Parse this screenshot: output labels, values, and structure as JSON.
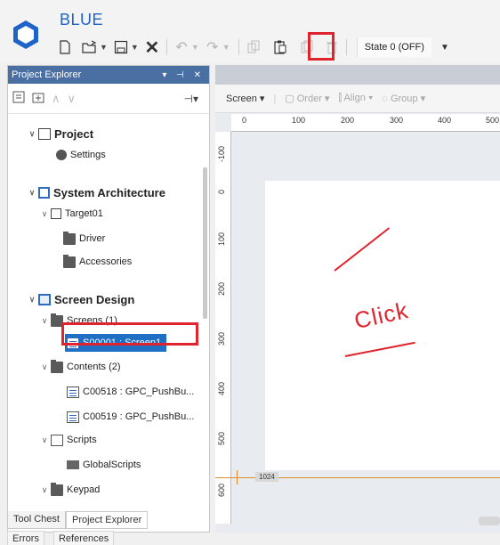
{
  "app": {
    "title": "BLUE"
  },
  "toolbar": {
    "state_label": "State 0 (OFF)"
  },
  "panel": {
    "title": "Project Explorer"
  },
  "tree": {
    "project": "Project",
    "settings": "Settings",
    "system_architecture": "System Architecture",
    "target": "Target01",
    "driver": "Driver",
    "accessories": "Accessories",
    "screen_design": "Screen Design",
    "screens": "Screens (1)",
    "screen1": "S00001 : Screen1",
    "contents": "Contents (2)",
    "content1": "C00518 : GPC_PushBu...",
    "content2": "C00519 : GPC_PushBu...",
    "scripts": "Scripts",
    "global_scripts": "GlobalScripts",
    "keypad": "Keypad"
  },
  "bottom_tabs": {
    "tool_chest": "Tool Chest",
    "project_explorer": "Project Explorer",
    "errors": "Errors",
    "references": "References"
  },
  "editor": {
    "screen_menu": "Screen",
    "order": "Order",
    "align": "Align",
    "group": "Group",
    "ruler_x": [
      "0",
      "100",
      "200",
      "300",
      "400",
      "500"
    ],
    "ruler_y": [
      "-100",
      "0",
      "100",
      "200",
      "300",
      "400",
      "500",
      "600"
    ],
    "guide_value": "1024",
    "annotation": "Click"
  },
  "colors": {
    "accent": "#1e63c8",
    "highlight": "#e0232d",
    "selected": "#1f6fc5",
    "panel_header": "#4a6fa3"
  }
}
